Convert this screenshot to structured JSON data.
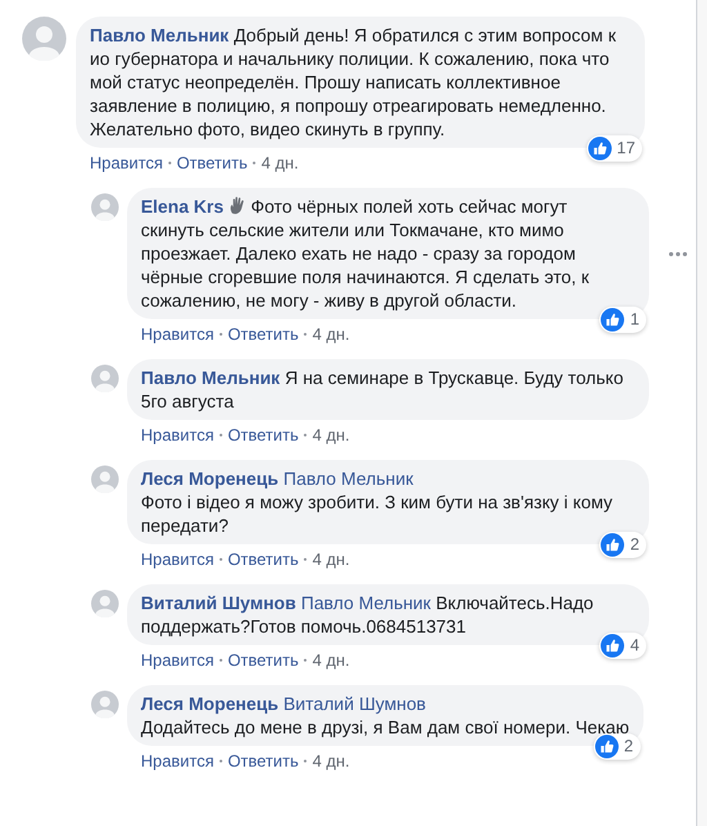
{
  "comments": [
    {
      "author": "Павло Мельник",
      "text": "Добрый день! Я обратился с этим вопросом к ио губернатора и начальнику полиции. К сожалению, пока что мой статус неопределён. Прошу написать коллективное заявление в полицию, я попрошу отреагировать немедленно. Желательно фото, видео скинуть в группу.",
      "reactions": "17",
      "actions": [
        "Нравится",
        "Ответить"
      ],
      "time": "4 дн.",
      "children": [
        {
          "author": "Elena Krs",
          "hand_icon": true,
          "menu_visible": true,
          "text": "Фото чёрных полей хоть сейчас могут скинуть сельские жители или Токмачане, кто мимо проезжает. Далеко ехать не надо - сразу за городом чёрные сгоревшие поля начинаются. Я сделать это, к сожалению, не могу - живу в другой области.",
          "reactions": "1",
          "actions": [
            "Нравится",
            "Ответить"
          ],
          "time": "4 дн."
        },
        {
          "author": "Павло Мельник",
          "text": "Я на семинаре в Трускавце. Буду только 5го августа",
          "actions": [
            "Нравится",
            "Ответить"
          ],
          "time": "4 дн."
        },
        {
          "author": "Леся Моренець",
          "reply_to": "Павло Мельник",
          "text_new_line": true,
          "text": "Фото і відео я можу зробити. З ким бути на зв'язку і кому передати?",
          "reactions": "2",
          "actions": [
            "Нравится",
            "Ответить"
          ],
          "time": "4 дн."
        },
        {
          "author": "Виталий Шумнов",
          "reply_to": "Павло Мельник",
          "text": "Включайтесь.Надо поддержать?Готов помочь.0684513731",
          "reactions": "4",
          "actions": [
            "Нравится",
            "Ответить"
          ],
          "time": "4 дн."
        },
        {
          "author": "Леся Моренець",
          "reply_to": "Виталий Шумнов",
          "text_new_line": true,
          "text": "Додайтесь до мене в друзі, я Вам дам свої номери. Чекаю",
          "reactions": "2",
          "actions": [
            "Нравится",
            "Ответить"
          ],
          "time": "4 дн."
        }
      ]
    }
  ]
}
